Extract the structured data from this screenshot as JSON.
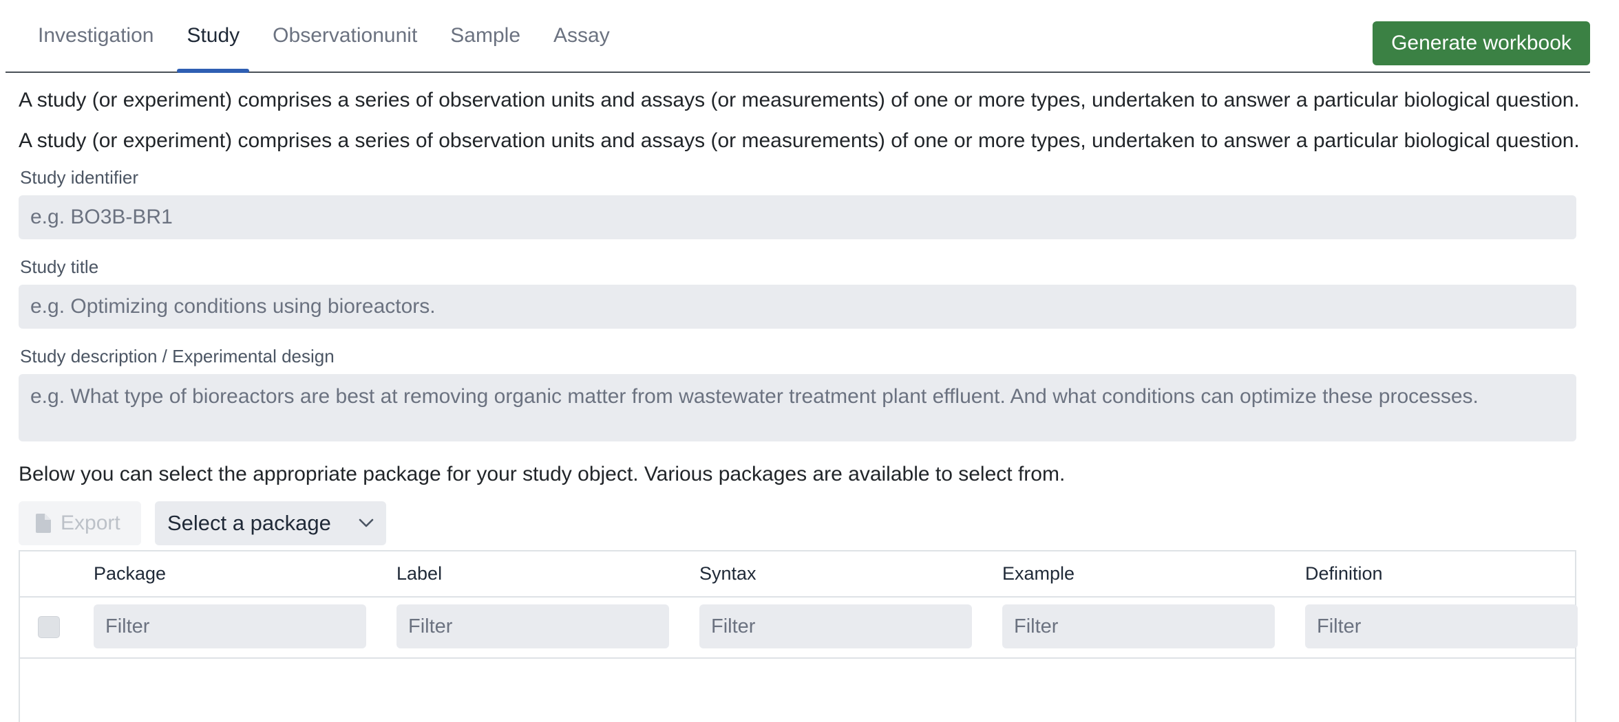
{
  "tabs": [
    {
      "label": "Investigation"
    },
    {
      "label": "Study"
    },
    {
      "label": "Observationunit"
    },
    {
      "label": "Sample"
    },
    {
      "label": "Assay"
    }
  ],
  "active_tab": "Study",
  "generate_button": "Generate workbook",
  "description_1": "A study (or experiment) comprises a series of observation units and assays (or measurements) of one or more types, undertaken to answer a particular biological question.",
  "description_2": "A study (or experiment) comprises a series of observation units and assays (or measurements) of one or more types, undertaken to answer a particular biological question.",
  "fields": {
    "identifier": {
      "label": "Study identifier",
      "placeholder": "e.g. BO3B-BR1",
      "value": ""
    },
    "title": {
      "label": "Study title",
      "placeholder": "e.g. Optimizing conditions using bioreactors.",
      "value": ""
    },
    "description": {
      "label": "Study description / Experimental design",
      "placeholder": "e.g. What type of bioreactors are best at removing organic matter from wastewater treatment plant effluent. And what conditions can optimize these processes.",
      "value": ""
    }
  },
  "package_help": "Below you can select the appropriate package for your study object. Various packages are available to select from.",
  "toolbar": {
    "export_label": "Export",
    "export_icon": "file-icon",
    "select_label": "Select a package",
    "select_icon": "chevron-down-icon"
  },
  "table": {
    "columns": [
      "Package",
      "Label",
      "Syntax",
      "Example",
      "Definition"
    ],
    "filter_placeholder": "Filter",
    "rows": []
  },
  "colors": {
    "accent_green": "#3b8144",
    "active_tab_underline": "#2f5fb3",
    "input_bg": "#e9ebef"
  }
}
